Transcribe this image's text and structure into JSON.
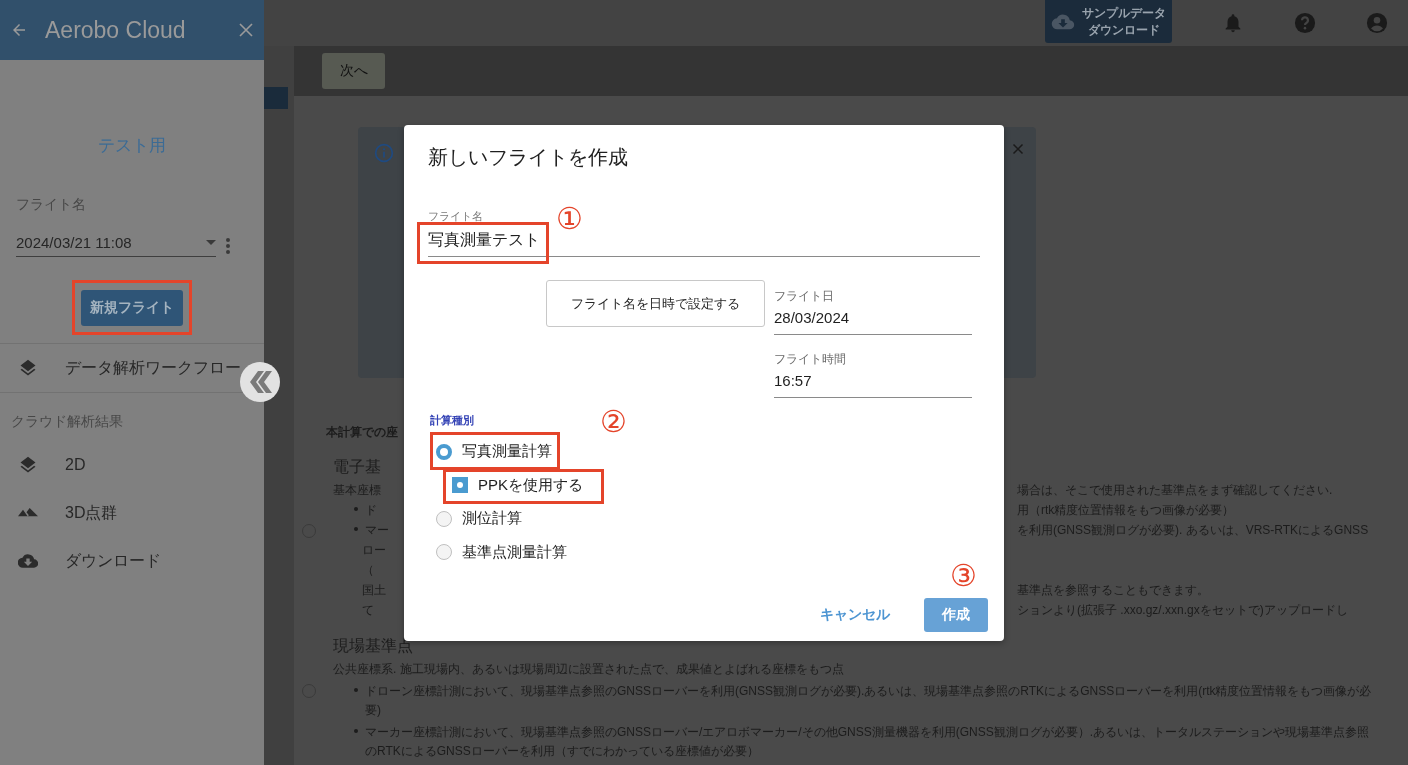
{
  "sidebar": {
    "title": "Aerobo Cloud",
    "project": "テスト用",
    "flight_label": "フライト名",
    "flight_value": "2024/03/21 11:08",
    "new_flight_button": {
      "label": "新規フライト",
      "highlighted": true
    },
    "workflow_item": "データ解析ワークフロー",
    "section": "クラウド解析結果",
    "items": [
      {
        "label": "2D",
        "kind": "layers"
      },
      {
        "label": "3D点群",
        "kind": "mountains"
      },
      {
        "label": "ダウンロード",
        "kind": "download"
      }
    ]
  },
  "header": {
    "sample_button": "サンプルデータダウンロード"
  },
  "toolbar": {
    "next_button": "次へ"
  },
  "content": {
    "intro": "本計算での座",
    "options": [
      {
        "selected": false,
        "lines": [
          {
            "kind": "heading",
            "left": "電子基"
          },
          {
            "kind": "text",
            "left": "基本座標",
            "right": "場合は、そこで使用された基準点をまず確認してください."
          },
          {
            "kind": "bullet",
            "left": "ド",
            "right": "用（rtk精度位置情報をもつ画像が必要）"
          },
          {
            "kind": "bullet",
            "left": "マー",
            "right": "を利用(GNSS観測ログが必要). あるいは、VRS-RTKによるGNSS"
          },
          {
            "kind": "cont",
            "left": "ロー"
          },
          {
            "kind": "cont",
            "left": "（"
          },
          {
            "kind": "cont",
            "left": "国土",
            "right": "基準点を参照することもできます。"
          },
          {
            "kind": "cont",
            "left": "て",
            "right": "ションより(拡張子 .xxo.gz/.xxn.gxをセットで)アップロードし"
          }
        ]
      },
      {
        "selected": false,
        "lines": [
          {
            "kind": "heading",
            "left": "現場基準点"
          },
          {
            "kind": "text",
            "left": "公共座標系. 施工現場内、あるいは現場周辺に設置された点で、成果値とよばれる座標をもつ点"
          },
          {
            "kind": "bullet",
            "left": "ドローン座標計測において、現場基準点参照のGNSSローバーを利用(GNSS観測ログが必要).あるいは、現場基準点参照のRTKによるGNSSローバーを利用(rtk精度位置情報をもつ画像が必要)"
          },
          {
            "kind": "bullet",
            "left": "マーカー座標計測において、現場基準点参照のGNSSローバー/エアロボマーカー/その他GNSS測量機器を利用(GNSS観測ログが必要）.あるいは、トータルステーションや現場基準点参照のRTKによるGNSSローバーを利用（すでにわかっている座標値が必要）"
          }
        ]
      }
    ]
  },
  "dialog": {
    "title": "新しいフライトを作成",
    "name_field": {
      "label": "フライト名",
      "value": "写真測量テスト",
      "highlighted": true,
      "callout": "①"
    },
    "set_name_button": "フライト名を日時で設定する",
    "date_field": {
      "label": "フライト日",
      "value": "28/03/2024"
    },
    "time_field": {
      "label": "フライト時間",
      "value": "16:57"
    },
    "calc_label": "計算種別",
    "calc_options": [
      {
        "label": "写真測量計算",
        "selected": true,
        "highlighted": true,
        "callout": "②",
        "ppk": {
          "label": "PPKを使用する",
          "checked": true,
          "highlighted": true
        }
      },
      {
        "label": "測位計算",
        "selected": false
      },
      {
        "label": "基準点測量計算",
        "selected": false
      }
    ],
    "cancel_button": "キャンセル",
    "create_button": {
      "label": "作成",
      "callout": "③"
    }
  }
}
